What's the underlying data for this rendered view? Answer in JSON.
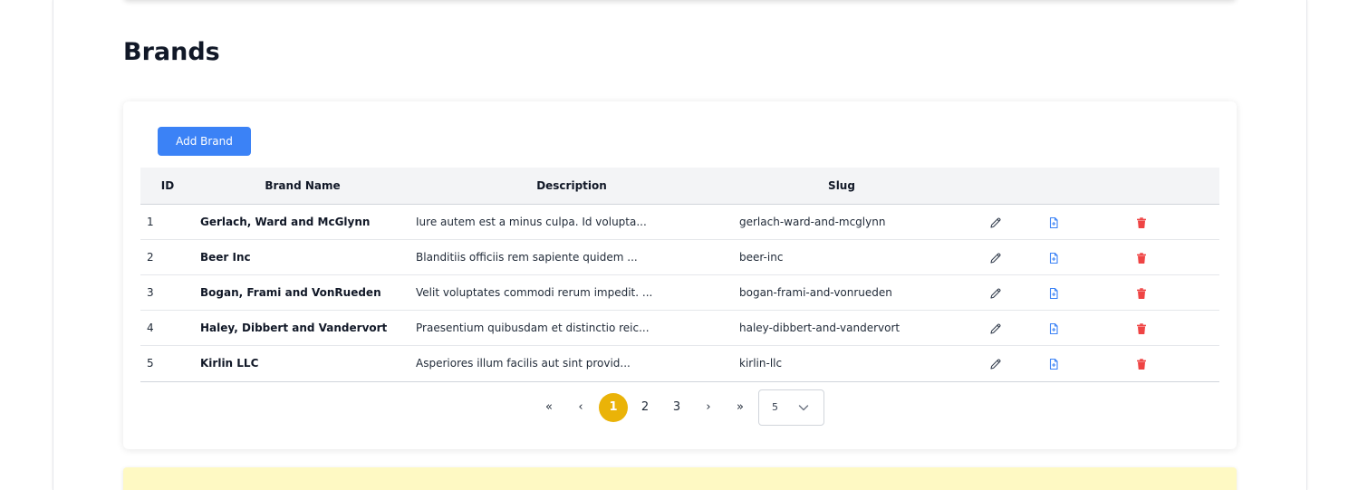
{
  "page": {
    "title": "Brands"
  },
  "toolbar": {
    "add_label": "Add Brand"
  },
  "table": {
    "columns": [
      "ID",
      "Brand Name",
      "Description",
      "Slug"
    ],
    "rows": [
      {
        "id": "1",
        "name": "Gerlach, Ward and McGlynn",
        "description": "Iure autem est a minus culpa. Id volupta...",
        "slug": "gerlach-ward-and-mcglynn"
      },
      {
        "id": "2",
        "name": "Beer Inc",
        "description": "Blanditiis officiis rem sapiente quidem ...",
        "slug": "beer-inc"
      },
      {
        "id": "3",
        "name": "Bogan, Frami and VonRueden",
        "description": "Velit voluptates commodi rerum impedit. ...",
        "slug": "bogan-frami-and-vonrueden"
      },
      {
        "id": "4",
        "name": "Haley, Dibbert and Vandervort",
        "description": "Praesentium quibusdam et distinctio reic...",
        "slug": "haley-dibbert-and-vandervort"
      },
      {
        "id": "5",
        "name": "Kirlin LLC",
        "description": "Asperiores illum facilis aut sint provid...",
        "slug": "kirlin-llc"
      }
    ],
    "row_actions": [
      "pencil-icon",
      "document-icon",
      "trash-icon"
    ]
  },
  "pagination": {
    "first": "«",
    "prev": "‹",
    "pages": [
      "1",
      "2",
      "3"
    ],
    "current": "1",
    "next": "›",
    "last": "»",
    "per_page": "5"
  },
  "colors": {
    "primary": "#3b82f6",
    "active_page": "#eab308",
    "danger": "#ef4444",
    "info_icon": "#3b82f6",
    "alert_bg": "#fef9c3"
  }
}
